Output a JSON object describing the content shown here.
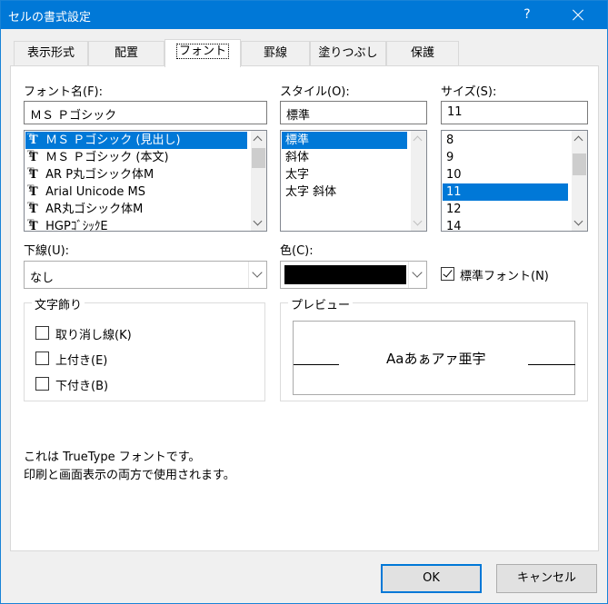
{
  "window": {
    "title": "セルの書式設定",
    "help": "?"
  },
  "tabs": [
    {
      "label": "表示形式"
    },
    {
      "label": "配置"
    },
    {
      "label": "フォント"
    },
    {
      "label": "罫線"
    },
    {
      "label": "塗りつぶし"
    },
    {
      "label": "保護"
    }
  ],
  "font": {
    "label": "フォント名(F):",
    "value": "ＭＳ Ｐゴシック",
    "items": [
      "ＭＳ Ｐゴシック (見出し)",
      "ＭＳ Ｐゴシック (本文)",
      "AR P丸ゴシック体M",
      "Arial Unicode MS",
      "AR丸ゴシック体M",
      "HGPｺﾞｼｯｸE"
    ]
  },
  "style": {
    "label": "スタイル(O):",
    "value": "標準",
    "items": [
      "標準",
      "斜体",
      "太字",
      "太字 斜体"
    ]
  },
  "size": {
    "label": "サイズ(S):",
    "value": "11",
    "items": [
      "8",
      "9",
      "10",
      "11",
      "12",
      "14"
    ]
  },
  "underline": {
    "label": "下線(U):",
    "value": "なし"
  },
  "color": {
    "label": "色(C):",
    "value": "#000000"
  },
  "normal_font": {
    "label": "標準フォント(N)",
    "checked": true
  },
  "effects": {
    "title": "文字飾り",
    "strikethrough": "取り消し線(K)",
    "superscript": "上付き(E)",
    "subscript": "下付き(B)"
  },
  "preview": {
    "title": "プレビュー",
    "sample": "Aaあぁアァ亜宇"
  },
  "info": {
    "line1": "これは TrueType フォントです。",
    "line2": "印刷と画面表示の両方で使用されます。"
  },
  "buttons": {
    "ok": "OK",
    "cancel": "キャンセル"
  },
  "colors": {
    "accent": "#0078d7",
    "face": "#f0f0f0"
  }
}
